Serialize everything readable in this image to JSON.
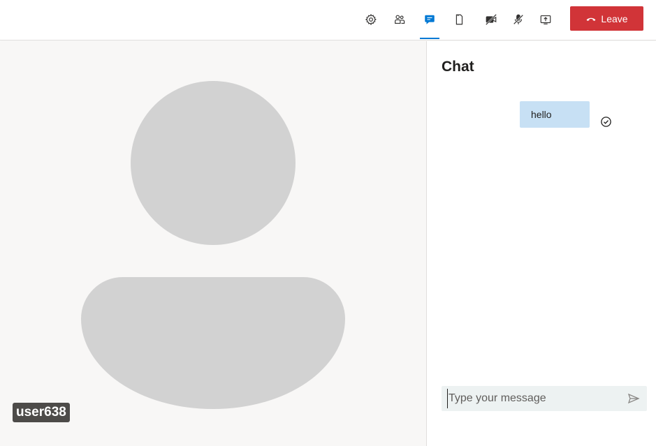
{
  "toolbar": {
    "buttons": [
      {
        "id": "settings",
        "icon": "gear-icon"
      },
      {
        "id": "people",
        "icon": "people-icon"
      },
      {
        "id": "chat",
        "icon": "chat-icon",
        "active": true
      },
      {
        "id": "device",
        "icon": "device-icon"
      },
      {
        "id": "camera",
        "icon": "camera-off-icon"
      },
      {
        "id": "microphone",
        "icon": "microphone-off-icon"
      },
      {
        "id": "share",
        "icon": "share-screen-icon"
      }
    ],
    "leave_label": "Leave"
  },
  "colors": {
    "accent": "#0078d4",
    "leave": "#d13438",
    "bubble": "#c7e0f4",
    "avatar": "#d2d2d2",
    "stage": "#f8f7f6"
  },
  "stage": {
    "participant_name": "user638"
  },
  "chat": {
    "title": "Chat",
    "messages": [
      {
        "text": "hello",
        "status": "read"
      }
    ],
    "composer": {
      "placeholder": "Type your message"
    }
  }
}
